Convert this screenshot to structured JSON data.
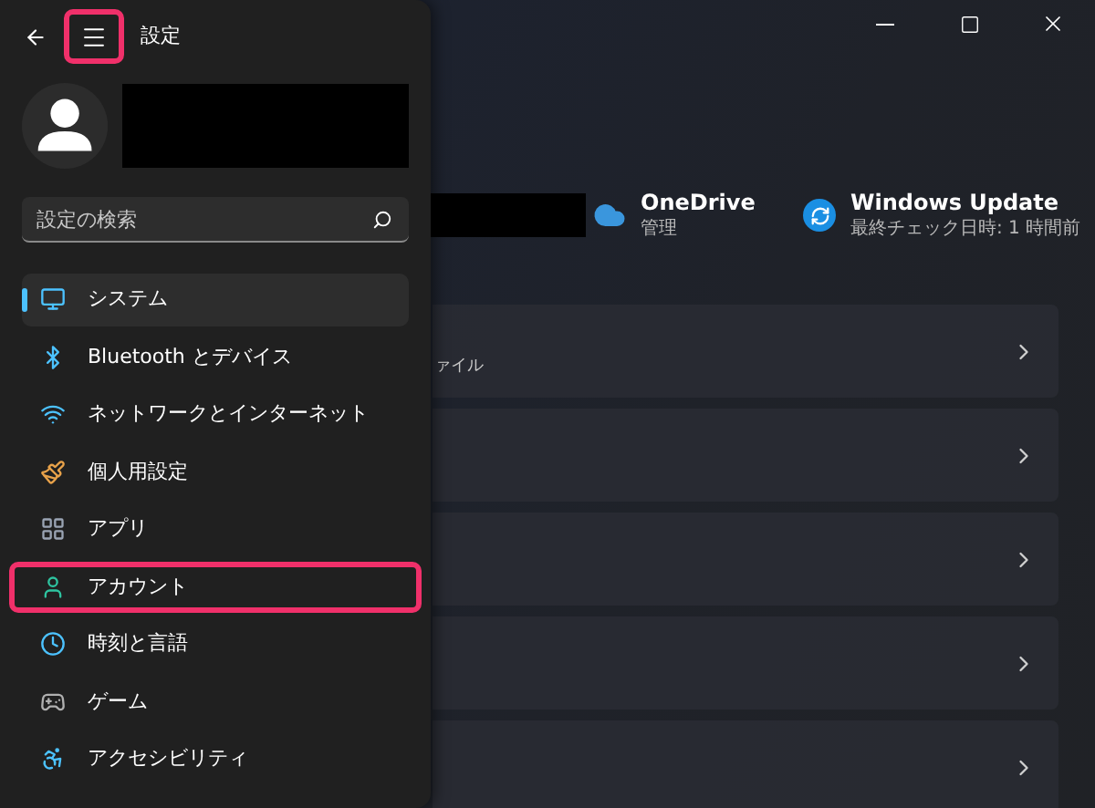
{
  "window": {
    "title": "設定"
  },
  "nav_pane": {
    "menu_button": {
      "highlighted": true
    },
    "search": {
      "placeholder": "設定の検索"
    },
    "items": [
      {
        "label": "システム",
        "selected": true,
        "highlighted": false
      },
      {
        "label": "Bluetooth とデバイス",
        "selected": false,
        "highlighted": false
      },
      {
        "label": "ネットワークとインターネット",
        "selected": false,
        "highlighted": false
      },
      {
        "label": "個人用設定",
        "selected": false,
        "highlighted": false
      },
      {
        "label": "アプリ",
        "selected": false,
        "highlighted": false
      },
      {
        "label": "アカウント",
        "selected": false,
        "highlighted": true
      },
      {
        "label": "時刻と言語",
        "selected": false,
        "highlighted": false
      },
      {
        "label": "ゲーム",
        "selected": false,
        "highlighted": false
      },
      {
        "label": "アクセシビリティ",
        "selected": false,
        "highlighted": false
      }
    ]
  },
  "header_tiles": [
    {
      "title": "OneDrive",
      "subtitle": "管理"
    },
    {
      "title": "Windows Update",
      "subtitle": "最終チェック日時: 1 時間前"
    }
  ],
  "cards": [
    {
      "kind": "text",
      "subtitle": "ァイル"
    },
    {
      "kind": "blank"
    },
    {
      "kind": "blank"
    },
    {
      "kind": "blank"
    },
    {
      "kind": "blank"
    }
  ]
}
